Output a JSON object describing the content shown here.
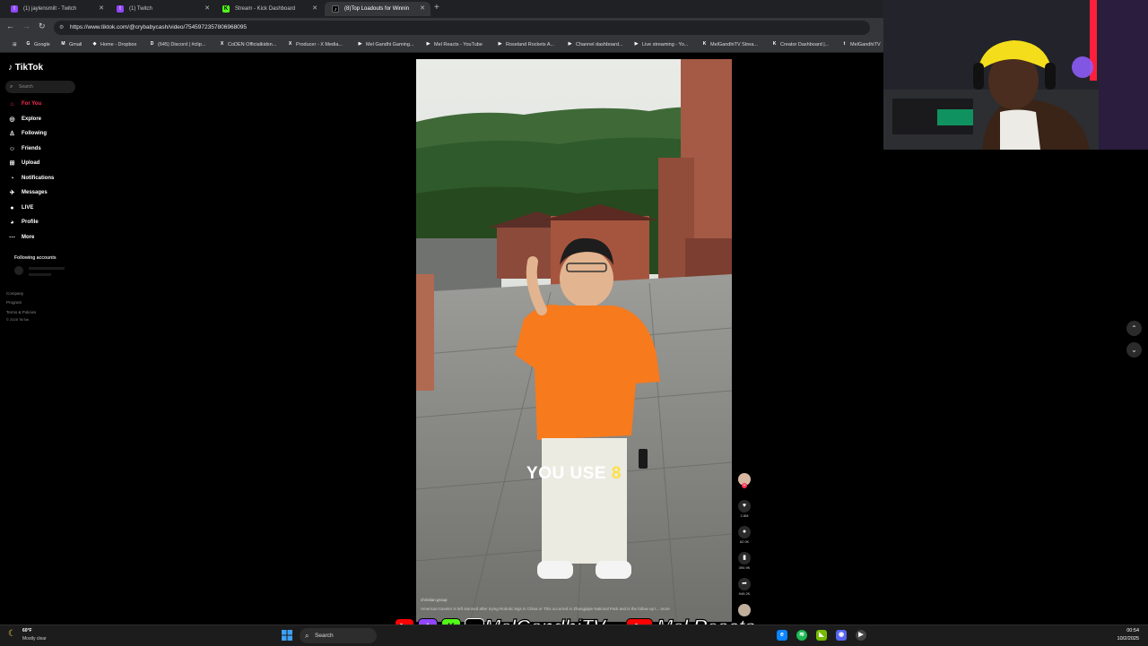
{
  "browser": {
    "tabs": [
      {
        "title": "(1) jaylensmilt - Twitch",
        "icon": "twitch-icon",
        "color": "#9146ff",
        "glyph": "t"
      },
      {
        "title": "(1) Twitch",
        "icon": "twitch-icon",
        "color": "#9146ff",
        "glyph": "t"
      },
      {
        "title": "Stream - Kick Dashboard",
        "icon": "kick-icon",
        "color": "#53fc18",
        "glyph": "K"
      },
      {
        "title": "(8)Top Loadouts for Winnin",
        "icon": "tiktok-icon",
        "color": "#000000",
        "glyph": "♪",
        "active": true
      }
    ],
    "new_tab": "+",
    "url": "https://www.tiktok.com/@crybabycash/video/7545972357806968095",
    "bookmarks": [
      {
        "label": "Google",
        "color": "#4285f4",
        "glyph": "G"
      },
      {
        "label": "Gmail",
        "color": "#ea4335",
        "glyph": "M"
      },
      {
        "label": "Home - Dropbox",
        "color": "#0061ff",
        "glyph": "◆"
      },
      {
        "label": "(645) Discord | #clip...",
        "color": "#5865f2",
        "glyph": "D"
      },
      {
        "label": "CoDEN Officialkidsn...",
        "color": "#000000",
        "glyph": "X"
      },
      {
        "label": "Producer - X Media...",
        "color": "#000000",
        "glyph": "X"
      },
      {
        "label": "Mel Gandhi Gaming...",
        "color": "#ff0000",
        "glyph": "▶"
      },
      {
        "label": "Mel Reacts - YouTube",
        "color": "#ff0000",
        "glyph": "▶"
      },
      {
        "label": "Roseland Rockets A...",
        "color": "#ff0000",
        "glyph": "▶"
      },
      {
        "label": "Channel dashboard...",
        "color": "#ff0000",
        "glyph": "▶"
      },
      {
        "label": "Live streaming - Yo...",
        "color": "#ff0000",
        "glyph": "▶"
      },
      {
        "label": "MelGandhiTV Strea...",
        "color": "#53fc18",
        "glyph": "K"
      },
      {
        "label": "Creator Dashboard |...",
        "color": "#53fc18",
        "glyph": "K"
      },
      {
        "label": "MelGandhiTV",
        "color": "#9146ff",
        "glyph": "t"
      }
    ]
  },
  "tiktok": {
    "logo": "TikTok",
    "search_placeholder": "Search",
    "nav": [
      {
        "label": "For You",
        "icon": "home-icon",
        "glyph": "⌂",
        "active": true
      },
      {
        "label": "Explore",
        "icon": "compass-icon",
        "glyph": "◎"
      },
      {
        "label": "Following",
        "icon": "following-icon",
        "glyph": "♙"
      },
      {
        "label": "Friends",
        "icon": "friends-icon",
        "glyph": "☺"
      },
      {
        "label": "Upload",
        "icon": "upload-icon",
        "glyph": "⊞"
      },
      {
        "label": "Notifications",
        "icon": "bell-icon",
        "glyph": "◔"
      },
      {
        "label": "Messages",
        "icon": "message-icon",
        "glyph": "✈"
      },
      {
        "label": "LIVE",
        "icon": "live-icon",
        "glyph": "●"
      },
      {
        "label": "Profile",
        "icon": "profile-icon",
        "glyph": "◕"
      },
      {
        "label": "More",
        "icon": "more-icon",
        "glyph": "⋯"
      }
    ],
    "following_accounts": "Following accounts",
    "footer": [
      "Company",
      "Program",
      "Terms & Policies",
      "© 2025 TikTok"
    ],
    "video": {
      "caption_part1": "YOU USE ",
      "caption_part2": "8",
      "author": "christian.group",
      "description": "American traveler is left stunned after trying Robotic legs in China or  This occurred in Zhangjiajie National Park and is the follow up t...  more"
    },
    "actions": [
      {
        "icon": "heart-icon",
        "glyph": "♥",
        "count": "2.8M"
      },
      {
        "icon": "comment-icon",
        "glyph": "●",
        "count": "62.0K"
      },
      {
        "icon": "bookmark-icon",
        "glyph": "▮",
        "count": "390.9K"
      },
      {
        "icon": "share-icon",
        "glyph": "➦",
        "count": "949.2K"
      }
    ],
    "scroll_up": "⌃",
    "scroll_down": "⌄"
  },
  "overlay": {
    "channel": "MelGandhiTV",
    "youtube_name": "Mel Reacts"
  },
  "taskbar": {
    "temperature": "60°F",
    "weather": "Mostly clear",
    "search": "Search",
    "time": "00:54",
    "date": "10/2/2025"
  },
  "colors": {
    "tiktok_accent": "#fe2c55",
    "shirt": "#f77a1d"
  }
}
